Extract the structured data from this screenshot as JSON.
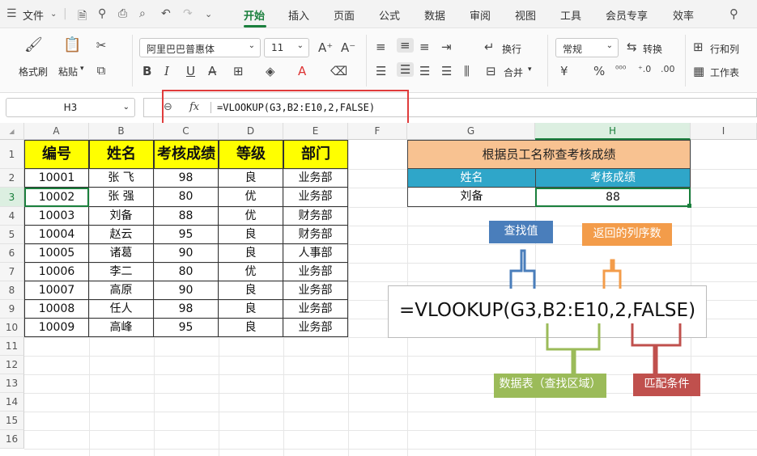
{
  "menubar": {
    "file_label": "文件",
    "tabs": [
      "开始",
      "插入",
      "页面",
      "公式",
      "数据",
      "审阅",
      "视图",
      "工具",
      "会员专享",
      "效率"
    ],
    "active_tab": "开始"
  },
  "ribbon": {
    "format_painter": "格式刷",
    "paste": "粘贴",
    "font_name": "阿里巴巴普惠体",
    "font_size": "11",
    "wrap": "换行",
    "merge": "合并",
    "number_format": "常规",
    "convert": "转换",
    "row_col": "行和列",
    "worksheet": "工作表"
  },
  "formula_bar": {
    "name_box": "H3",
    "fx": "fx",
    "formula": "=VLOOKUP(G3,B2:E10,2,FALSE)"
  },
  "columns": [
    "A",
    "B",
    "C",
    "D",
    "E",
    "F",
    "G",
    "H",
    "I"
  ],
  "rows": [
    "1",
    "2",
    "3",
    "4",
    "5",
    "6",
    "7",
    "8",
    "9",
    "10",
    "11",
    "12",
    "13",
    "14",
    "15",
    "16"
  ],
  "table": {
    "headers": [
      "编号",
      "姓名",
      "考核成绩",
      "等级",
      "部门"
    ],
    "rows": [
      [
        "10001",
        "张 飞",
        "98",
        "良",
        "业务部"
      ],
      [
        "10002",
        "张 强",
        "80",
        "优",
        "业务部"
      ],
      [
        "10003",
        "刘备",
        "88",
        "优",
        "财务部"
      ],
      [
        "10004",
        "赵云",
        "95",
        "良",
        "财务部"
      ],
      [
        "10005",
        "诸葛",
        "90",
        "良",
        "人事部"
      ],
      [
        "10006",
        "李二",
        "80",
        "优",
        "业务部"
      ],
      [
        "10007",
        "高原",
        "90",
        "良",
        "业务部"
      ],
      [
        "10008",
        "任人",
        "98",
        "良",
        "业务部"
      ],
      [
        "10009",
        "高峰",
        "95",
        "良",
        "业务部"
      ]
    ]
  },
  "lookup": {
    "title": "根据员工名称查考核成绩",
    "col1": "姓名",
    "col2": "考核成绩",
    "name": "刘备",
    "score": "88"
  },
  "annotation": {
    "formula": "=VLOOKUP(G3,B2:E10,2,FALSE)",
    "lookup_value": "查找值",
    "col_index": "返回的列序数",
    "table_array": "数据表（查找区域）",
    "match_type": "匹配条件"
  },
  "colors": {
    "accent": "#1a7f3c",
    "header_yellow": "#ffff00",
    "title_orange": "#f8c291",
    "lookup_blue": "#2fa6c9",
    "label_blue": "#4a7ebb",
    "label_orange": "#f39c4a",
    "label_green": "#9bbb59",
    "label_red": "#c0504d"
  }
}
